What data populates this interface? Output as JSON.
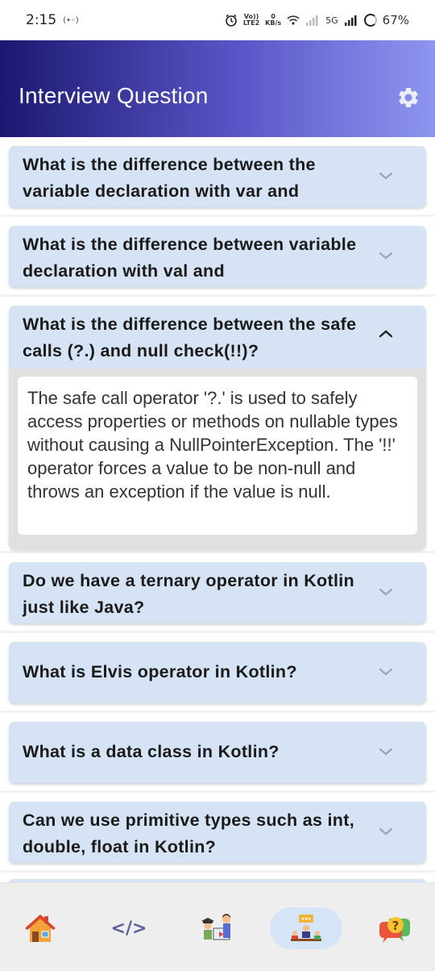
{
  "status_bar": {
    "time": "2:15",
    "radio": "(•◦)",
    "volte_top": "Vo))",
    "volte_bottom": "LTE2",
    "speed_top": "0",
    "speed_bottom": "KB/s",
    "network": "5G",
    "battery": "67%"
  },
  "header": {
    "title": "Interview Question",
    "settings_icon": "gear-icon"
  },
  "questions": [
    {
      "text": "What is the difference between the variable declaration with var and",
      "expanded": false
    },
    {
      "text": "What is the difference between variable declaration with val and",
      "expanded": false
    },
    {
      "text": "What is the difference between the safe calls (?.) and null check(!!)?",
      "expanded": true,
      "answer": "The safe call operator '?.' is used to safely access properties or methods on nullable types without causing a NullPointerException. The '!!' operator forces a value to be non-null and throws an exception if the value is null."
    },
    {
      "text": "Do we have a ternary operator in Kotlin just like Java?",
      "expanded": false
    },
    {
      "text": "What is Elvis operator in Kotlin?",
      "expanded": false
    },
    {
      "text": "What is a data class in Kotlin?",
      "expanded": false
    },
    {
      "text": "Can we use primitive types such as int, double, float in Kotlin?",
      "expanded": false
    }
  ],
  "bottom_nav": {
    "items": [
      {
        "icon": "home-icon",
        "active": false
      },
      {
        "icon": "code-icon",
        "active": false
      },
      {
        "icon": "teacher-icon",
        "active": false
      },
      {
        "icon": "interview-icon",
        "active": true
      },
      {
        "icon": "help-chat-icon",
        "active": false
      }
    ],
    "code_glyph": "</>",
    "help_glyph": "?"
  },
  "colors": {
    "header_start": "#1c1870",
    "header_end": "#8e96ef",
    "card": "#d5e3f4",
    "active_nav": "#d5e5f7"
  }
}
